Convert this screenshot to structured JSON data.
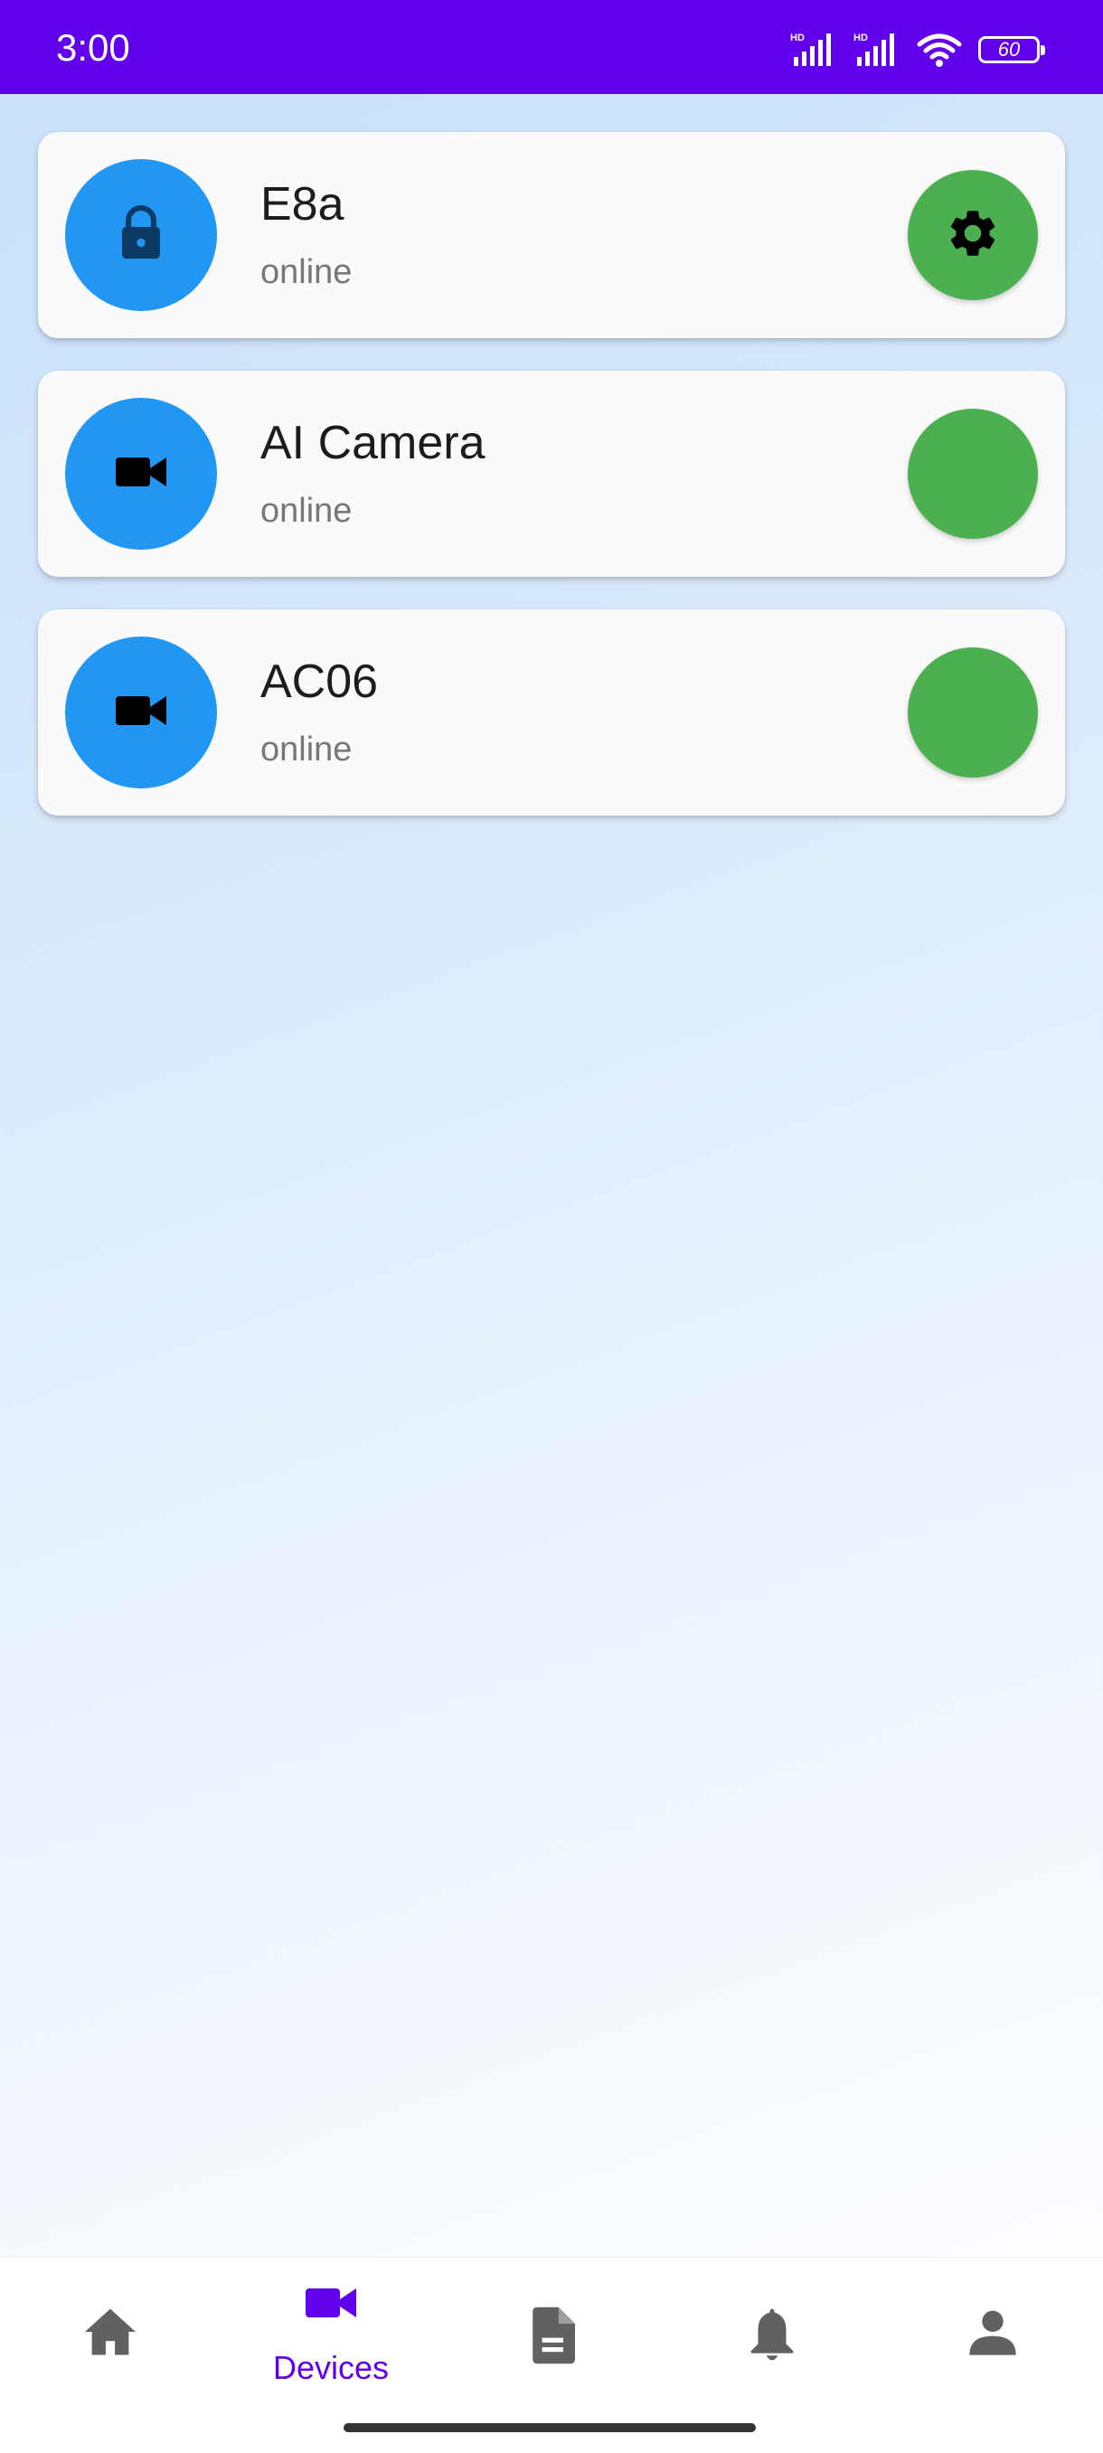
{
  "status_bar": {
    "time": "3:00",
    "battery": "60",
    "icons": [
      "hd-signal-icon",
      "hd-signal-icon",
      "wifi-icon",
      "battery-icon"
    ]
  },
  "devices": [
    {
      "name": "E8a",
      "status": "online",
      "icon": "lock-icon",
      "action_icon": "gear-icon"
    },
    {
      "name": "AI Camera",
      "status": "online",
      "icon": "videocam-icon",
      "action_icon": ""
    },
    {
      "name": "AC06",
      "status": "online",
      "icon": "videocam-icon",
      "action_icon": ""
    }
  ],
  "bottom_nav": {
    "items": [
      {
        "icon": "home-icon",
        "label": ""
      },
      {
        "icon": "videocam-icon",
        "label": "Devices",
        "active": true
      },
      {
        "icon": "document-icon",
        "label": ""
      },
      {
        "icon": "bell-icon",
        "label": ""
      },
      {
        "icon": "person-icon",
        "label": ""
      }
    ]
  },
  "colors": {
    "status_bar": "#6200ee",
    "avatar": "#2196f3",
    "action": "#4caf50",
    "nav_active": "#6200ee",
    "nav_inactive": "#616161"
  }
}
